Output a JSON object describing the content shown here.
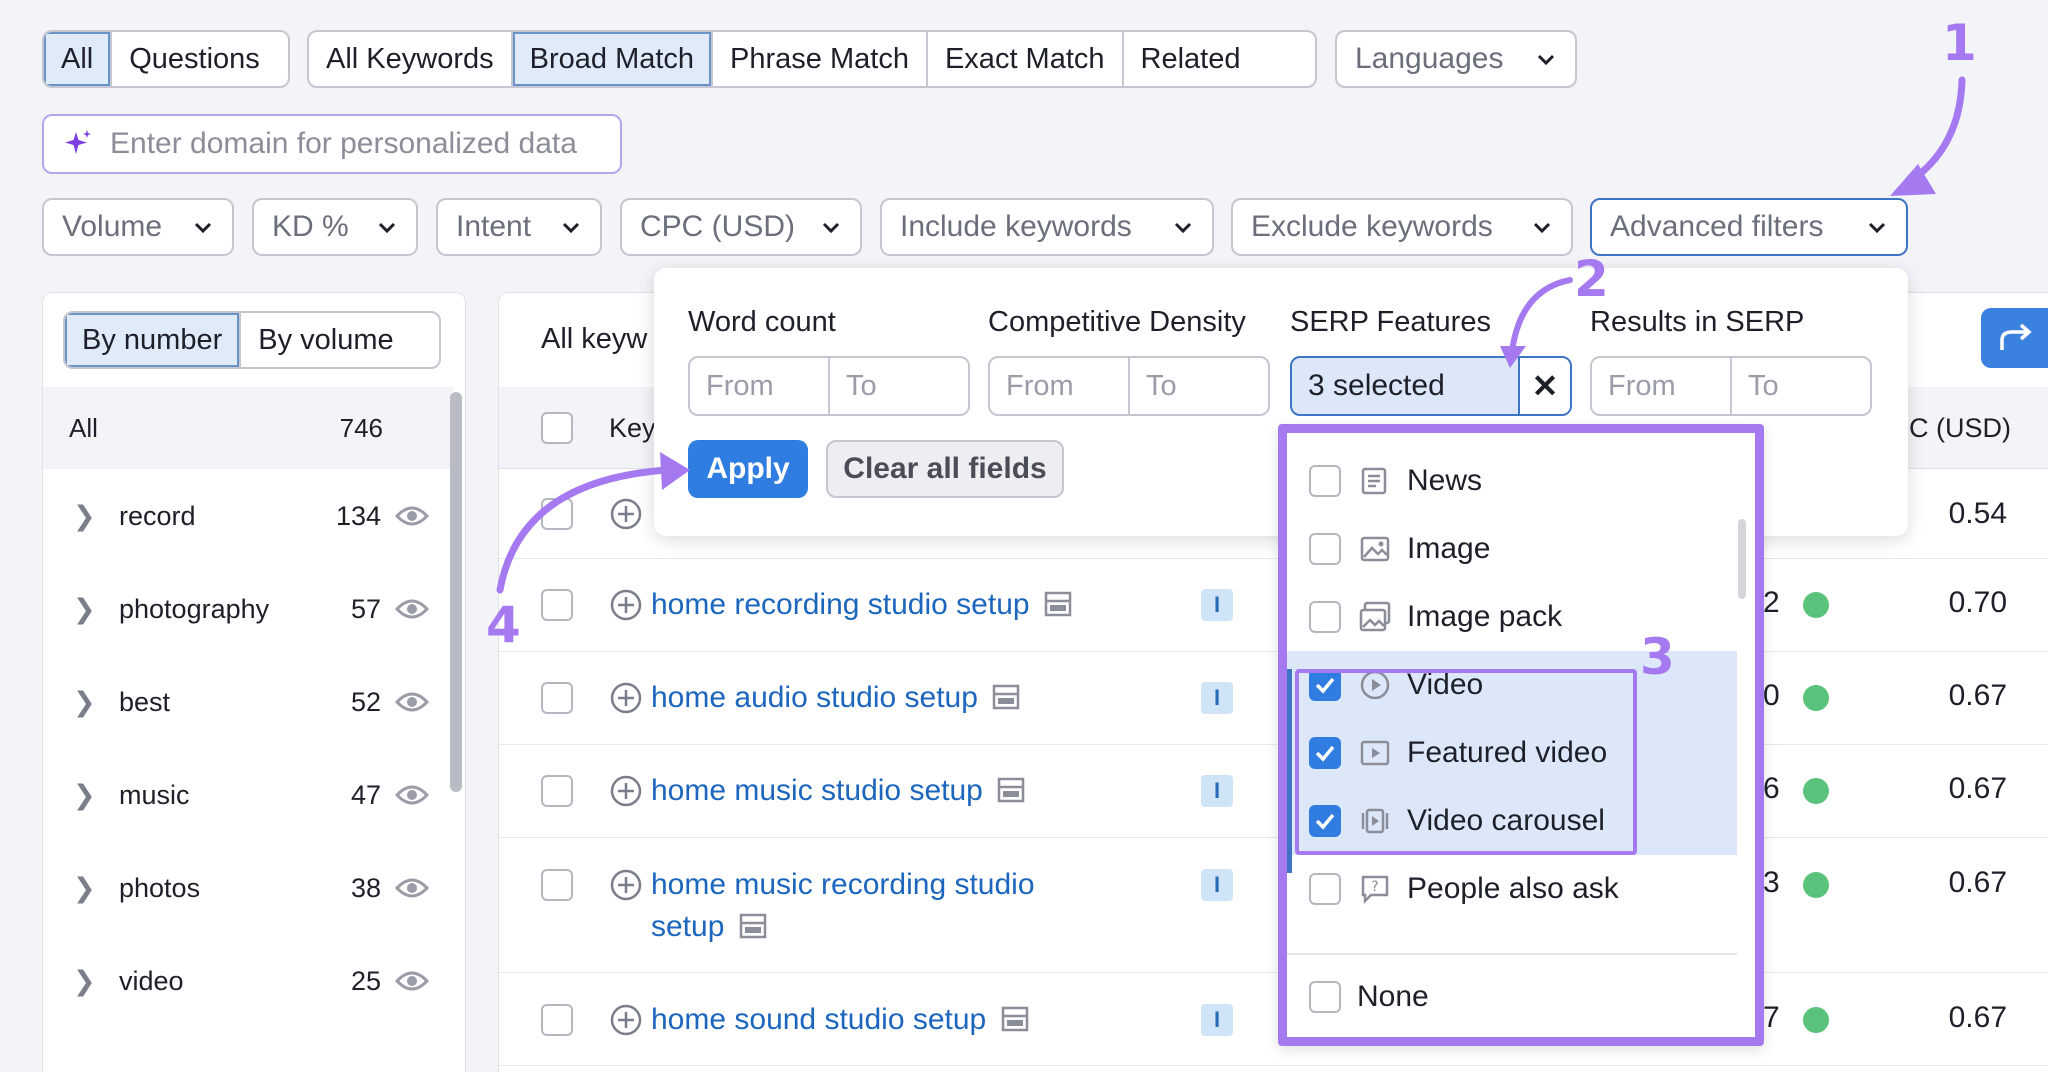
{
  "tabs_a": [
    "All",
    "Questions"
  ],
  "tabs_b": [
    "All Keywords",
    "Broad Match",
    "Phrase Match",
    "Exact Match",
    "Related"
  ],
  "languages": "Languages",
  "domain_placeholder": "Enter domain for personalized data",
  "filters": [
    "Volume",
    "KD %",
    "Intent",
    "CPC (USD)",
    "Include keywords",
    "Exclude keywords",
    "Advanced filters"
  ],
  "left_panel": {
    "toggle": [
      "By number",
      "By volume"
    ],
    "all_label": "All",
    "all_count": "746",
    "groups": [
      {
        "name": "record",
        "count": "134"
      },
      {
        "name": "photography",
        "count": "57"
      },
      {
        "name": "best",
        "count": "52"
      },
      {
        "name": "music",
        "count": "47"
      },
      {
        "name": "photos",
        "count": "38"
      },
      {
        "name": "video",
        "count": "25"
      }
    ]
  },
  "main_panel": {
    "title": "All keyw",
    "col_keyword": "Key",
    "col_cpc": "C (USD)",
    "rows": [
      {
        "keyword": "",
        "intent": "",
        "kd": "",
        "cpc": "0.54"
      },
      {
        "keyword": "home recording studio setup",
        "intent": "I",
        "kd": "2",
        "cpc": "0.70"
      },
      {
        "keyword": "home audio studio setup",
        "intent": "I",
        "kd": "0",
        "cpc": "0.67"
      },
      {
        "keyword": "home music studio setup",
        "intent": "I",
        "kd": "6",
        "cpc": "0.67"
      },
      {
        "keyword_line1": "home music recording studio",
        "keyword_line2": "setup",
        "intent": "I",
        "kd": "3",
        "cpc": "0.67"
      },
      {
        "keyword": "home sound studio setup",
        "intent": "I",
        "kd": "7",
        "cpc": "0.67"
      }
    ]
  },
  "advanced": {
    "word_count": "Word count",
    "comp_density": "Competitive Density",
    "serp_features": "SERP Features",
    "results_in_serp": "Results in SERP",
    "from": "From",
    "to": "To",
    "selected_text": "3 selected",
    "clear_x": "✕",
    "apply": "Apply",
    "clear_all": "Clear all fields"
  },
  "serp_options": [
    {
      "label": "News",
      "checked": false,
      "icon": "news-icon"
    },
    {
      "label": "Image",
      "checked": false,
      "icon": "image-icon"
    },
    {
      "label": "Image pack",
      "checked": false,
      "icon": "image-pack-icon"
    },
    {
      "label": "Video",
      "checked": true,
      "icon": "video-icon"
    },
    {
      "label": "Featured video",
      "checked": true,
      "icon": "featured-video-icon"
    },
    {
      "label": "Video carousel",
      "checked": true,
      "icon": "video-carousel-icon"
    },
    {
      "label": "People also ask",
      "checked": false,
      "icon": "people-also-ask-icon"
    }
  ],
  "serp_none": "None",
  "annotations": [
    "1",
    "2",
    "3",
    "4"
  ],
  "colors": {
    "accent": "#a579f0",
    "primary": "#2f7de1",
    "link": "#1d66bd"
  }
}
